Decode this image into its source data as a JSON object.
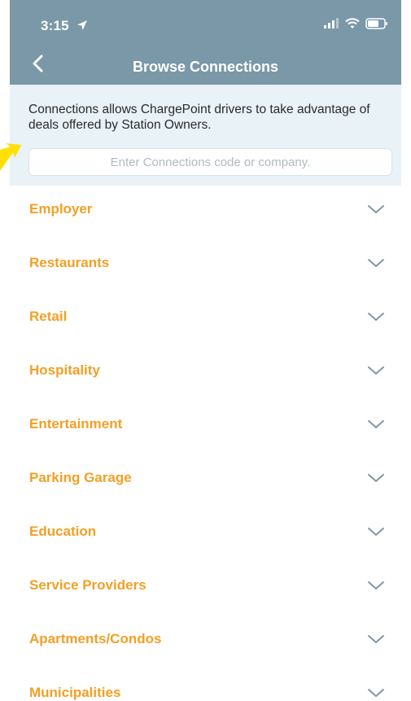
{
  "status_bar": {
    "time": "3:15"
  },
  "nav": {
    "title": "Browse Connections"
  },
  "intro": {
    "text": "Connections allows ChargePoint drivers to take advantage of deals offered by Station Owners."
  },
  "search": {
    "placeholder": "Enter Connections code or company."
  },
  "categories": [
    {
      "label": "Employer"
    },
    {
      "label": "Restaurants"
    },
    {
      "label": "Retail"
    },
    {
      "label": "Hospitality"
    },
    {
      "label": "Entertainment"
    },
    {
      "label": "Parking Garage"
    },
    {
      "label": "Education"
    },
    {
      "label": "Service Providers"
    },
    {
      "label": "Apartments/Condos"
    },
    {
      "label": "Municipalities"
    }
  ],
  "colors": {
    "header_bg": "#7a98a8",
    "panel_bg": "#e9f2f7",
    "category_text": "#f2a024",
    "chevron": "#7f97a6",
    "pointer_arrow": "#ffe000"
  }
}
